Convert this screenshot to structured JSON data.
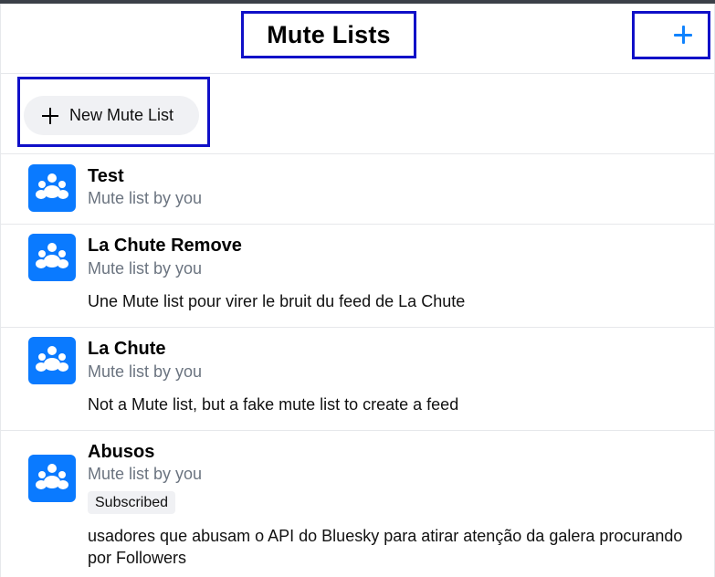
{
  "header": {
    "title": "Mute Lists",
    "add_icon": "plus-icon"
  },
  "new_list": {
    "label": "New Mute List",
    "icon": "plus-icon"
  },
  "lists": [
    {
      "name": "Test",
      "subtitle": "Mute list by you",
      "description": "",
      "badge": ""
    },
    {
      "name": "La Chute Remove",
      "subtitle": "Mute list by you",
      "description": "Une Mute list pour virer le bruit du feed de La Chute",
      "badge": ""
    },
    {
      "name": "La Chute",
      "subtitle": "Mute list by you",
      "description": "Not a Mute list, but a fake mute list to create a feed",
      "badge": ""
    },
    {
      "name": "Abusos",
      "subtitle": "Mute list by you",
      "description": "usadores que abusam o API do Bluesky para atirar atenção da galera procurando por Followers",
      "badge": "Subscribed"
    }
  ],
  "colors": {
    "accent": "#1083fe",
    "avatar": "#0a7aff",
    "highlight_box": "#1010c8"
  }
}
